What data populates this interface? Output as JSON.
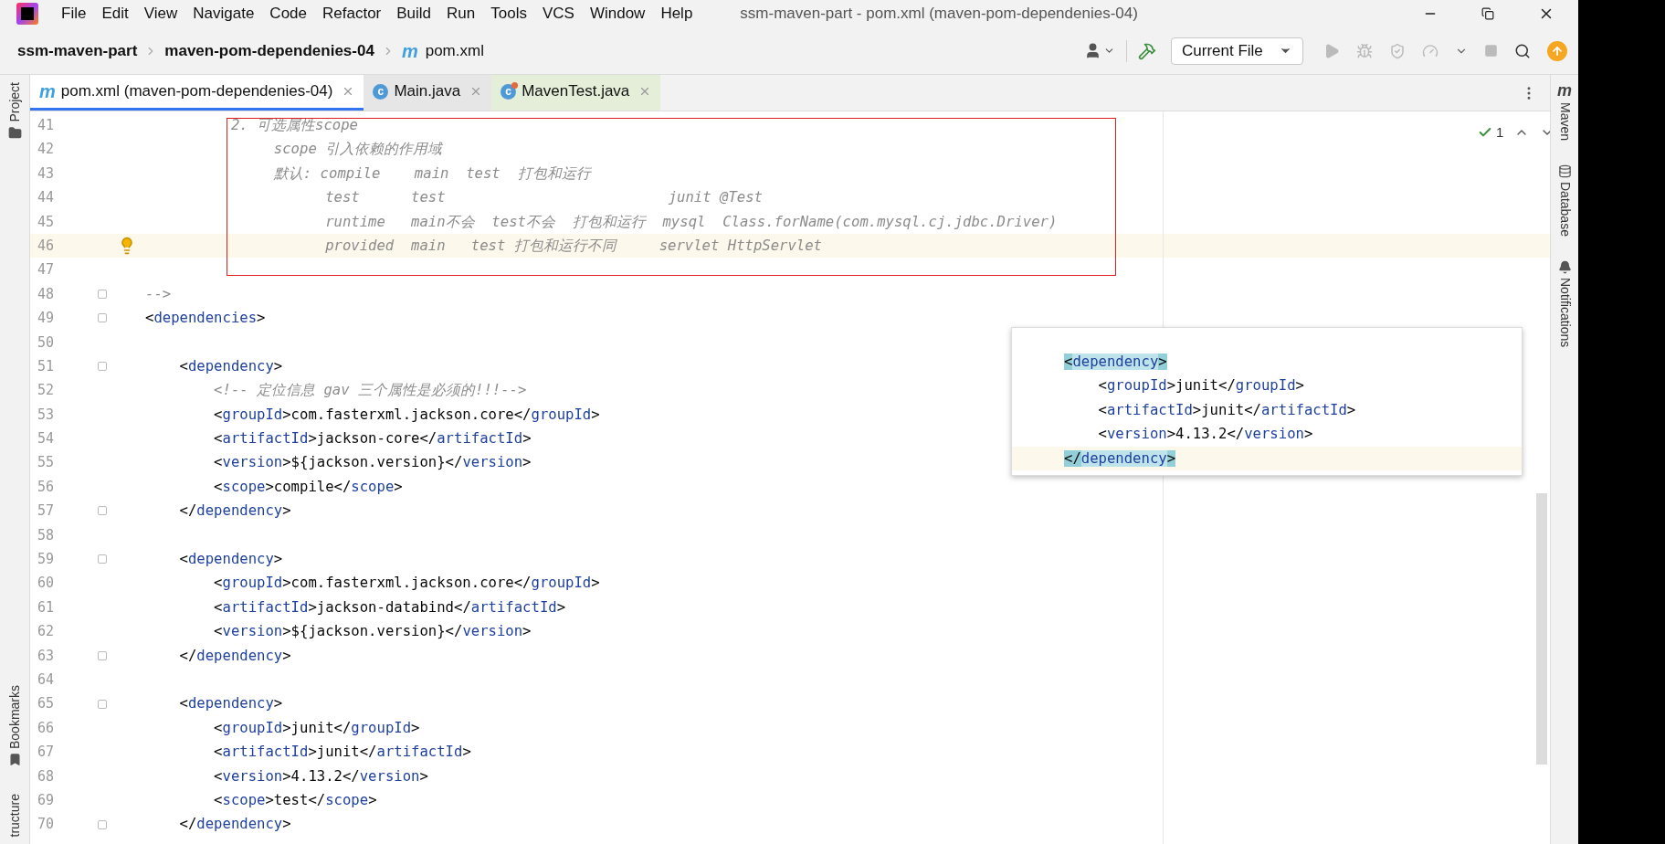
{
  "window": {
    "title": "ssm-maven-part - pom.xml (maven-pom-dependenies-04)"
  },
  "menu": [
    "File",
    "Edit",
    "View",
    "Navigate",
    "Code",
    "Refactor",
    "Build",
    "Run",
    "Tools",
    "VCS",
    "Window",
    "Help"
  ],
  "breadcrumbs": [
    {
      "label": "ssm-maven-part"
    },
    {
      "label": "maven-pom-dependenies-04"
    },
    {
      "label": "pom.xml",
      "icon": "m"
    }
  ],
  "toolbar": {
    "run_config": "Current File"
  },
  "tabs": [
    {
      "label": "pom.xml (maven-pom-dependenies-04)",
      "kind": "xml",
      "icon": "m",
      "selected": true
    },
    {
      "label": "Main.java",
      "kind": "class",
      "icon": "c",
      "selected": false
    },
    {
      "label": "MavenTest.java",
      "kind": "test",
      "icon": "c",
      "selected": false
    }
  ],
  "left_tools": [
    {
      "label": "Project",
      "kind": "folder"
    },
    {
      "label": "Bookmarks",
      "kind": "bookmark"
    },
    {
      "label": "tructure",
      "kind": "none"
    }
  ],
  "right_tools": [
    {
      "label": "Maven",
      "kind": "maven",
      "icon": "m"
    },
    {
      "label": "Database",
      "kind": "database"
    },
    {
      "label": "Notifications",
      "kind": "bell"
    }
  ],
  "inspection": {
    "count": "1"
  },
  "lines": [
    {
      "number": "41",
      "kind": "comment",
      "text": "          2. 可选属性scope",
      "fold": false,
      "current": false
    },
    {
      "number": "42",
      "kind": "comment",
      "text": "               scope 引入依赖的作用域",
      "fold": false,
      "current": false
    },
    {
      "number": "43",
      "kind": "comment",
      "text": "               默认: compile    main  test  打包和运行",
      "fold": false,
      "current": false
    },
    {
      "number": "44",
      "kind": "comment",
      "text": "                     test      test                          junit @Test",
      "fold": false,
      "current": false
    },
    {
      "number": "45",
      "kind": "comment",
      "text": "                     runtime   main不会  test不会  打包和运行  mysql  Class.forName(com.mysql.cj.jdbc.Driver)",
      "fold": false,
      "current": false
    },
    {
      "number": "46",
      "kind": "comment",
      "text": "                     provided  main   test 打包和运行不同     servlet HttpServlet",
      "fold": false,
      "current": true
    },
    {
      "number": "47",
      "kind": "blank",
      "fold": false,
      "current": false
    },
    {
      "number": "48",
      "kind": "comment",
      "text": "-->",
      "fold": true,
      "current": false
    },
    {
      "number": "49",
      "kind": "xml",
      "text": "<dependencies>",
      "fold": true,
      "current": false
    },
    {
      "number": "50",
      "kind": "blank",
      "fold": false,
      "current": false
    },
    {
      "number": "51",
      "kind": "xml",
      "text": "    <dependency>",
      "fold": true,
      "current": false
    },
    {
      "number": "52",
      "kind": "comment",
      "text": "        <!-- 定位信息 gav 三个属性是必须的!!!-->",
      "fold": false,
      "current": false
    },
    {
      "number": "53",
      "kind": "xml",
      "text": "        <groupId>com.fasterxml.jackson.core</groupId>",
      "fold": false,
      "current": false
    },
    {
      "number": "54",
      "kind": "xml",
      "text": "        <artifactId>jackson-core</artifactId>",
      "fold": false,
      "current": false
    },
    {
      "number": "55",
      "kind": "xml",
      "text": "        <version>${jackson.version}</version>",
      "fold": false,
      "current": false
    },
    {
      "number": "56",
      "kind": "xml",
      "text": "        <scope>compile</scope>",
      "fold": false,
      "current": false
    },
    {
      "number": "57",
      "kind": "xml",
      "text": "    </dependency>",
      "fold": true,
      "current": false
    },
    {
      "number": "58",
      "kind": "blank",
      "fold": false,
      "current": false
    },
    {
      "number": "59",
      "kind": "xml",
      "text": "    <dependency>",
      "fold": true,
      "current": false
    },
    {
      "number": "60",
      "kind": "xml",
      "text": "        <groupId>com.fasterxml.jackson.core</groupId>",
      "fold": false,
      "current": false
    },
    {
      "number": "61",
      "kind": "xml",
      "text": "        <artifactId>jackson-databind</artifactId>",
      "fold": false,
      "current": false
    },
    {
      "number": "62",
      "kind": "xml",
      "text": "        <version>${jackson.version}</version>",
      "fold": false,
      "current": false
    },
    {
      "number": "63",
      "kind": "xml",
      "text": "    </dependency>",
      "fold": true,
      "current": false
    },
    {
      "number": "64",
      "kind": "blank",
      "fold": false,
      "current": false
    },
    {
      "number": "65",
      "kind": "xml",
      "text": "    <dependency>",
      "fold": true,
      "current": false
    },
    {
      "number": "66",
      "kind": "xml",
      "text": "        <groupId>junit</groupId>",
      "fold": false,
      "current": false
    },
    {
      "number": "67",
      "kind": "xml",
      "text": "        <artifactId>junit</artifactId>",
      "fold": false,
      "current": false
    },
    {
      "number": "68",
      "kind": "xml",
      "text": "        <version>4.13.2</version>",
      "fold": false,
      "current": false
    },
    {
      "number": "69",
      "kind": "xml",
      "text": "        <scope>test</scope>",
      "fold": false,
      "current": false
    },
    {
      "number": "70",
      "kind": "xml",
      "text": "    </dependency>",
      "fold": true,
      "current": false
    }
  ],
  "popup": {
    "lines": [
      {
        "text": "<dependency>",
        "matched": true,
        "current": false
      },
      {
        "text": "    <groupId>junit</groupId>",
        "matched": false,
        "current": false
      },
      {
        "text": "    <artifactId>junit</artifactId>",
        "matched": false,
        "current": false
      },
      {
        "text": "    <version>4.13.2</version>",
        "matched": false,
        "current": false
      },
      {
        "text": "</dependency>",
        "matched": true,
        "current": true
      }
    ]
  }
}
